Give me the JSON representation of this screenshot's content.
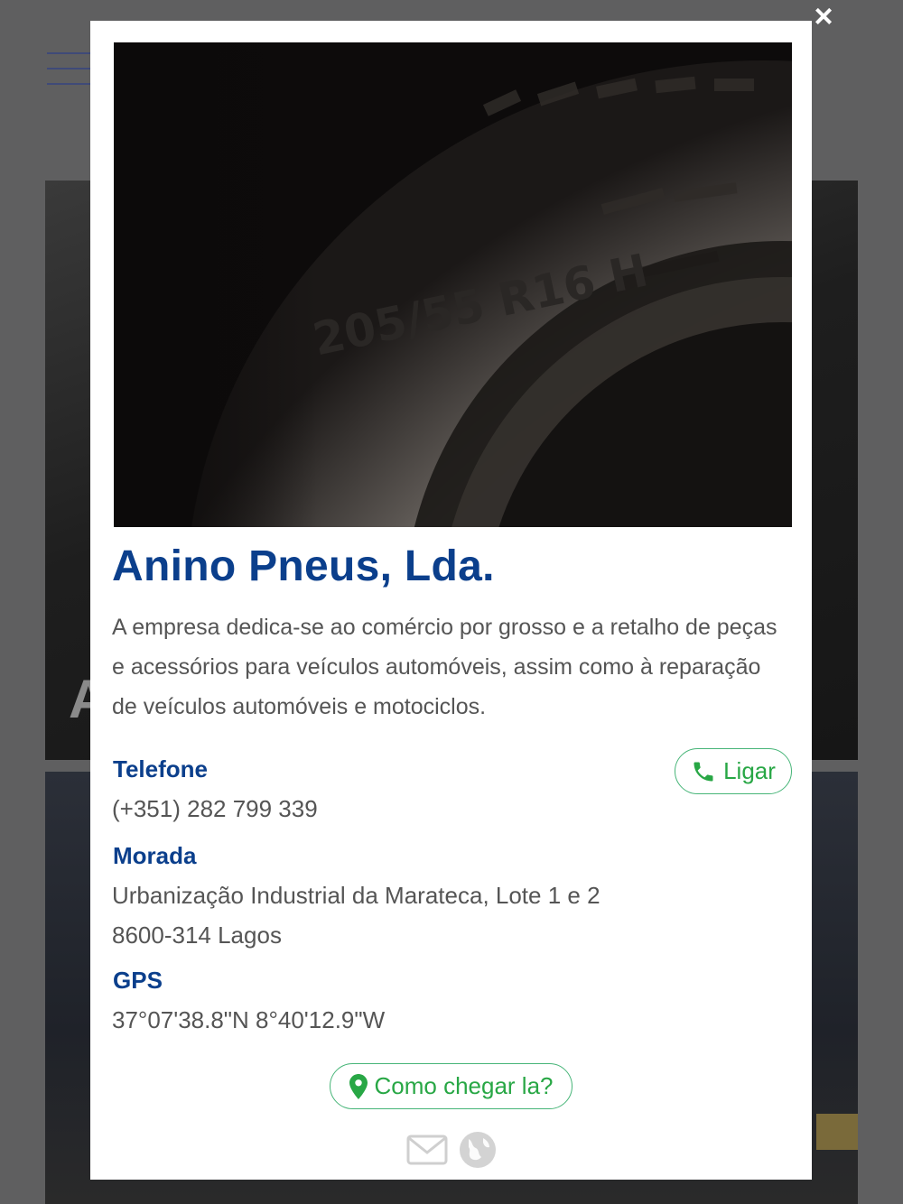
{
  "company": {
    "name": "Anino Pneus, Lda.",
    "description": "A empresa dedica-se ao comércio por grosso e a retalho de peças e acessórios para veículos automóveis, assim como à reparação de veículos automóveis e motociclos."
  },
  "hero_image": {
    "tire_marking": "205/55 R16 H"
  },
  "phone": {
    "label": "Telefone",
    "value": "(+351) 282 799 339",
    "call_button": "Ligar"
  },
  "address": {
    "label": "Morada",
    "line1": "Urbanização Industrial da Marateca, Lote 1 e 2",
    "line2": "8600-314 Lagos"
  },
  "gps": {
    "label": "GPS",
    "value": "37°07'38.8\"N 8°40'12.9\"W"
  },
  "directions_button": "Como chegar la?",
  "close_icon": "×",
  "background": {
    "partial_letter": "A"
  },
  "colors": {
    "brand_blue": "#0b3f8c",
    "action_green": "#28a745",
    "text_gray": "#555555",
    "overlay": "#5f5f60"
  },
  "icons": {
    "close": "close-icon",
    "phone": "phone-icon",
    "map_pin": "map-pin-icon",
    "email": "envelope-icon",
    "website": "globe-icon"
  }
}
